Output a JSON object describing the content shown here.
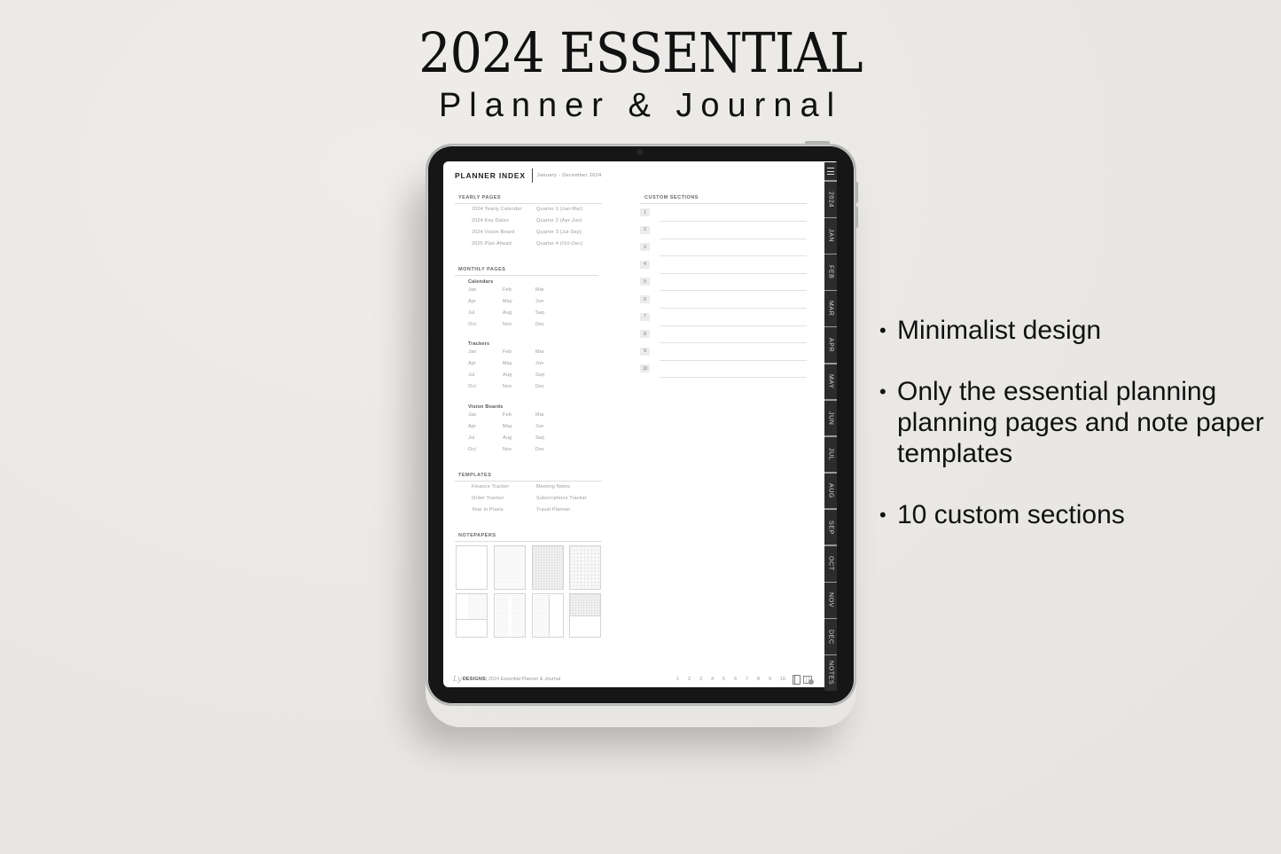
{
  "hero": {
    "title": "2024 ESSENTIAL",
    "subtitle": "Planner & Journal"
  },
  "features": [
    "Minimalist design",
    "Only the essential planning planning pages and note paper templates",
    "10 custom sections"
  ],
  "planner": {
    "title": "PLANNER INDEX",
    "date_range": "January - December 2024",
    "yearly": {
      "heading": "YEARLY PAGES",
      "left": [
        "2024 Yearly Calendar",
        "2024 Key Dates",
        "2024 Vision Board",
        "2025 Plan Ahead"
      ],
      "right": [
        "Quarter 1 (Jan-Mar)",
        "Quarter 2 (Apr-Jun)",
        "Quarter 3 (Jul-Sep)",
        "Quarter 4 (Oct-Dec)"
      ]
    },
    "monthly": {
      "heading": "MONTHLY PAGES",
      "groups": [
        {
          "name": "Calendars",
          "months": [
            "Jan",
            "Feb",
            "Mar",
            "Apr",
            "May",
            "Jun",
            "Jul",
            "Aug",
            "Sep",
            "Oct",
            "Nov",
            "Dec"
          ]
        },
        {
          "name": "Trackers",
          "months": [
            "Jan",
            "Feb",
            "Mar",
            "Apr",
            "May",
            "Jun",
            "Jul",
            "Aug",
            "Sep",
            "Oct",
            "Nov",
            "Dec"
          ]
        },
        {
          "name": "Vision Boards",
          "months": [
            "Jan",
            "Feb",
            "Mar",
            "Apr",
            "May",
            "Jun",
            "Jul",
            "Aug",
            "Sep",
            "Oct",
            "Nov",
            "Dec"
          ]
        }
      ]
    },
    "templates": {
      "heading": "TEMPLATES",
      "left": [
        "Finance Tracker",
        "Order Tracker",
        "Year in Pixels"
      ],
      "right": [
        "Meeting Notes",
        "Subscriptions Tracker",
        "Travel Planner"
      ]
    },
    "notepapers": {
      "heading": "NOTEPAPERS",
      "types": [
        "blank",
        "lined",
        "grid",
        "dot-grid",
        "cornell-lined",
        "two-column-lined",
        "sidebar-lined",
        "half-grid"
      ]
    },
    "custom_sections": {
      "heading": "CUSTOM SECTIONS",
      "numbers": [
        "1",
        "2",
        "3",
        "4",
        "5",
        "6",
        "7",
        "8",
        "9",
        "10"
      ]
    },
    "tabs": [
      "2024",
      "JAN",
      "FEB",
      "MAR",
      "APR",
      "MAY",
      "JUN",
      "JUL",
      "AUG",
      "SEP",
      "OCT",
      "NOV",
      "DEC",
      "NOTES"
    ],
    "footer": {
      "signature": "Ly",
      "brand": "DESIGNS",
      "product": " | 2024 Essential Planner & Journal",
      "pages": [
        "1",
        "2",
        "3",
        "4",
        "5",
        "6",
        "7",
        "8",
        "9",
        "10"
      ]
    }
  }
}
